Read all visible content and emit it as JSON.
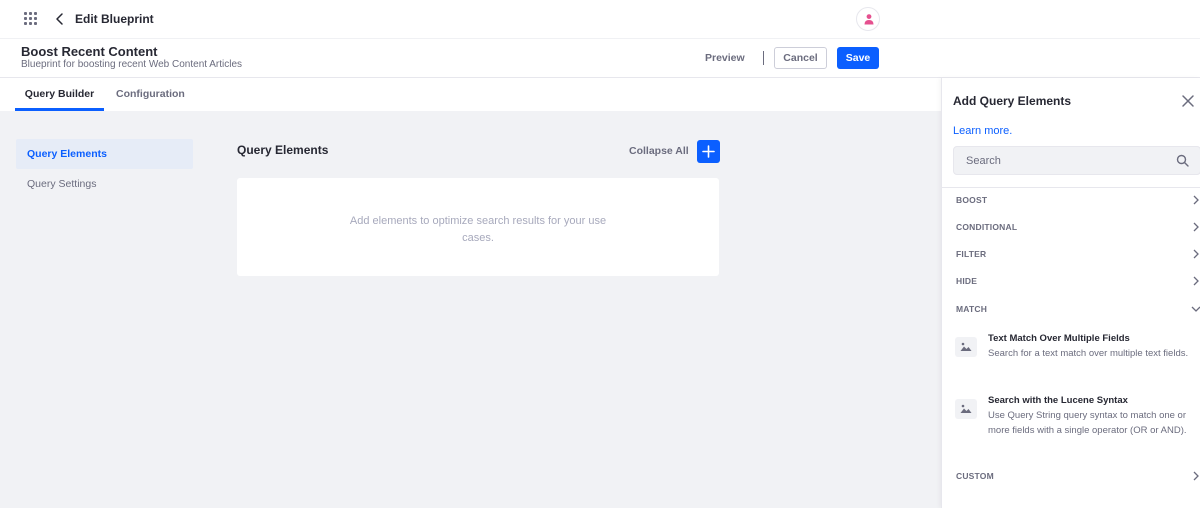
{
  "topnav": {
    "title": "Edit Blueprint"
  },
  "header": {
    "title": "Boost Recent Content",
    "description": "Blueprint for boosting recent Web Content Articles",
    "preview_label": "Preview",
    "cancel_label": "Cancel",
    "save_label": "Save"
  },
  "tabs": [
    {
      "label": "Query Builder",
      "active": true
    },
    {
      "label": "Configuration",
      "active": false
    }
  ],
  "sidebar": {
    "items": [
      {
        "label": "Query Elements",
        "active": true
      },
      {
        "label": "Query Settings",
        "active": false
      }
    ]
  },
  "main": {
    "title": "Query Elements",
    "collapse_all_label": "Collapse All",
    "empty_message": "Add elements to optimize search results for your use cases."
  },
  "panel": {
    "title": "Add Query Elements",
    "learn_more": "Learn more.",
    "search_placeholder": "Search",
    "categories": [
      {
        "label": "BOOST",
        "expanded": false
      },
      {
        "label": "CONDITIONAL",
        "expanded": false
      },
      {
        "label": "FILTER",
        "expanded": false
      },
      {
        "label": "HIDE",
        "expanded": false
      },
      {
        "label": "MATCH",
        "expanded": true
      },
      {
        "label": "CUSTOM",
        "expanded": false
      }
    ],
    "match_items": [
      {
        "title": "Text Match Over Multiple Fields",
        "description": "Search for a text match over multiple text fields."
      },
      {
        "title": "Search with the Lucene Syntax",
        "description": "Use Query String query syntax to match one or more fields with a single operator (OR or AND)."
      }
    ]
  },
  "colors": {
    "primary": "#0b5fff",
    "canvas_bg": "#f1f2f5",
    "text": "#272833",
    "muted": "#6b6c7e",
    "avatar_accent": "#e5508f"
  },
  "icons": [
    "apps-grid-icon",
    "chevron-left-icon",
    "user-icon",
    "plus-icon",
    "close-icon",
    "search-icon",
    "chevron-right-icon",
    "chevron-down-icon",
    "image-icon"
  ]
}
